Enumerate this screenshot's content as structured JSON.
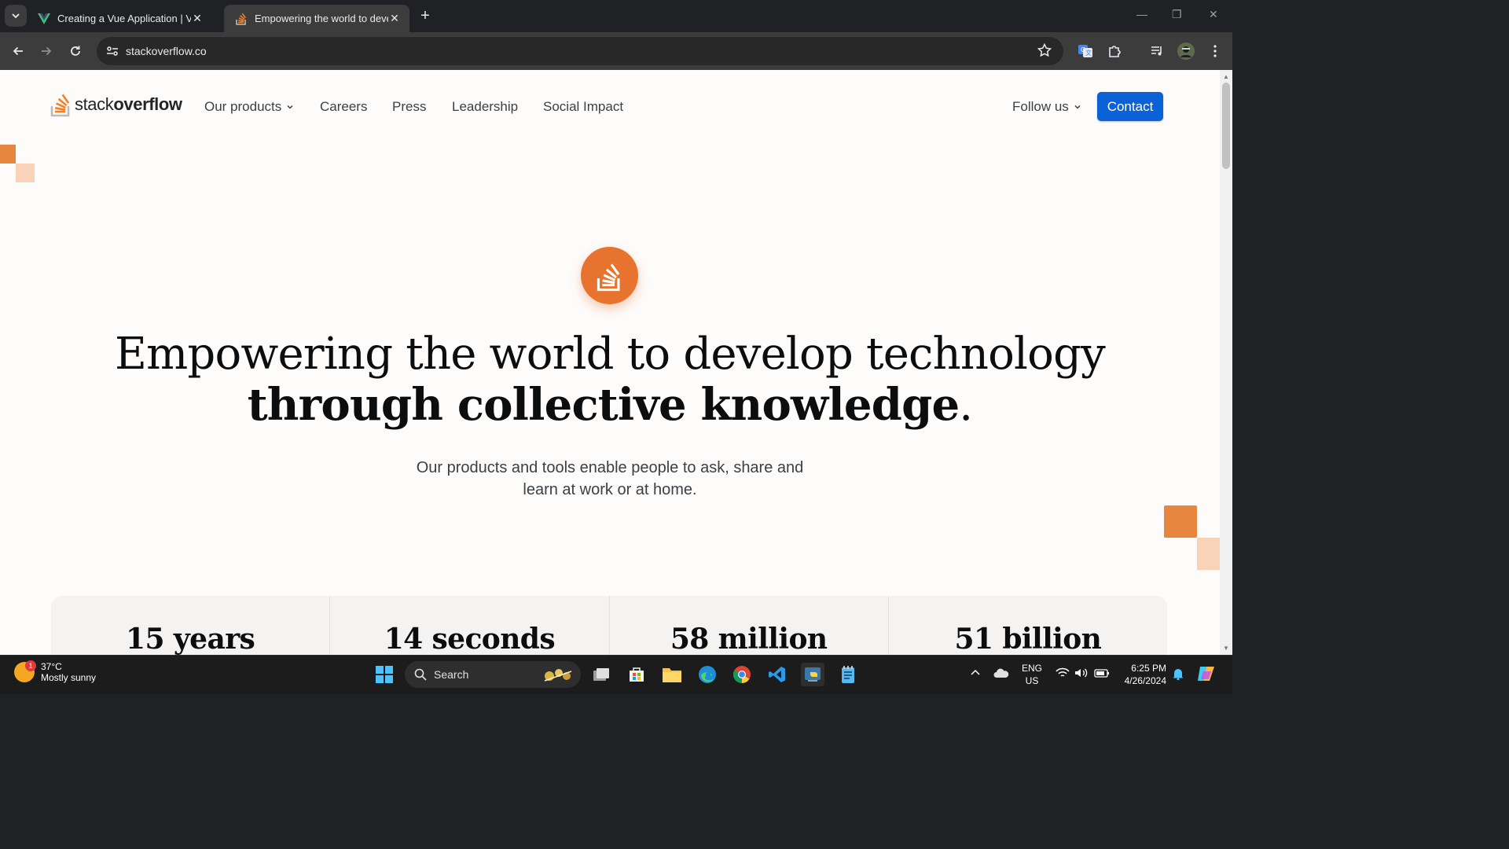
{
  "browser": {
    "tabs": [
      {
        "title": "Creating a Vue Application | Vue.js",
        "favicon": "vue-logo-icon",
        "active": false
      },
      {
        "title": "Empowering the world to develop technology",
        "favicon": "stackoverflow-favicon-icon",
        "active": true
      }
    ],
    "url": "stackoverflow.co"
  },
  "site": {
    "logo": {
      "light": "stack",
      "bold": "overflow"
    },
    "nav": [
      "Our products",
      "Careers",
      "Press",
      "Leadership",
      "Social Impact"
    ],
    "follow_label": "Follow us",
    "contact_label": "Contact",
    "colors": {
      "accent": "#e7732e",
      "contact": "#0a62d6",
      "deco_dark": "#e7873f",
      "deco_light": "#f8d3b8"
    }
  },
  "hero": {
    "title_line1": "Empowering the world to develop technology",
    "title_line2_bold": "through collective knowledge",
    "title_line2_end": ".",
    "subtitle_line1": "Our products and tools enable people to ask, share and",
    "subtitle_line2": "learn at work or at home."
  },
  "stats": [
    "15 years",
    "14 seconds",
    "58 million",
    "51 billion"
  ],
  "taskbar": {
    "weather_temp": "37°C",
    "weather_desc": "Mostly sunny",
    "weather_badge": "1",
    "search_placeholder": "Search",
    "lang_top": "ENG",
    "lang_bottom": "US",
    "time": "6:25 PM",
    "date": "4/26/2024"
  }
}
